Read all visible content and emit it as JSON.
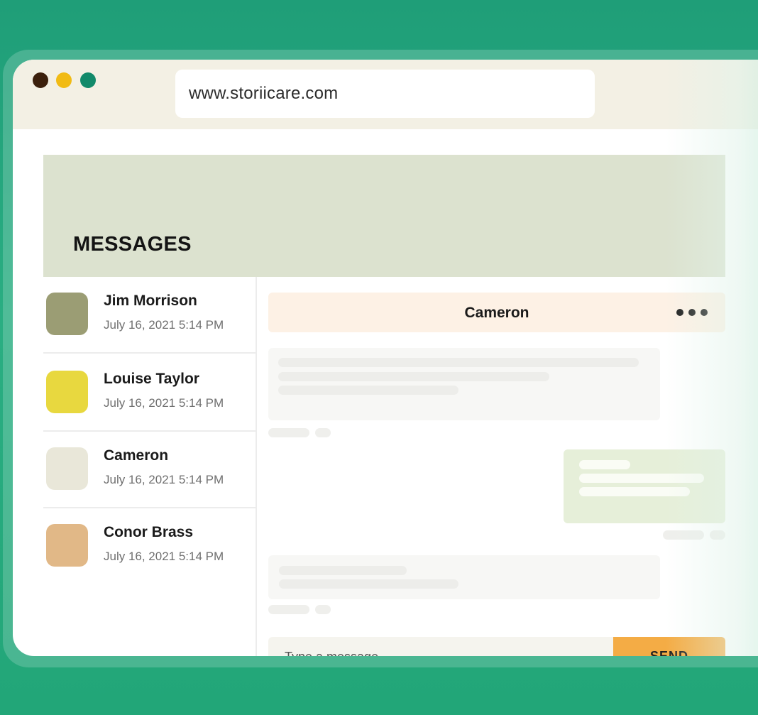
{
  "browser": {
    "url": "www.storiicare.com"
  },
  "messages": {
    "heading": "MESSAGES"
  },
  "contacts": [
    {
      "name": "Jim Morrison",
      "date": "July 16, 2021 5:14 PM",
      "avatar_color": "#9b9d74"
    },
    {
      "name": "Louise Taylor",
      "date": "July 16, 2021 5:14 PM",
      "avatar_color": "#e8d83f"
    },
    {
      "name": "Cameron",
      "date": "July 16, 2021 5:14 PM",
      "avatar_color": "#e9e7d9"
    },
    {
      "name": "Conor Brass",
      "date": "July 16, 2021 5:14 PM",
      "avatar_color": "#e1b887"
    }
  ],
  "chat": {
    "title": "Cameron",
    "more_icon": "more-horizontal-icon",
    "composer_placeholder": "Type a message...",
    "send_label": "SEND"
  },
  "colors": {
    "background": "#22a678",
    "send_button": "#f4ac45",
    "banner": "#dce2cf",
    "chat_header": "#fdf1e5"
  }
}
